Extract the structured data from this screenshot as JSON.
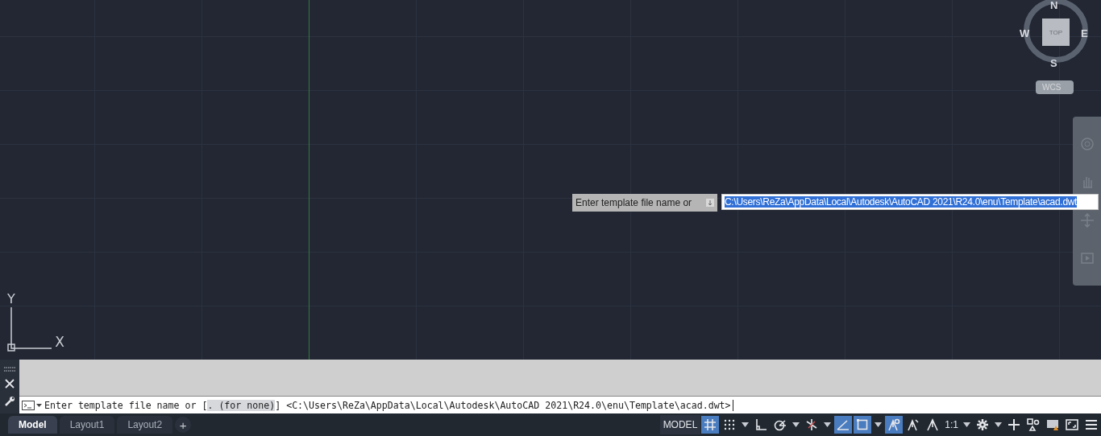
{
  "viewcube": {
    "north": "N",
    "south": "S",
    "east": "E",
    "west": "W",
    "face": "TOP",
    "wcs": "WCS"
  },
  "navigation_bar": {
    "tools": [
      {
        "kind": "steering"
      },
      {
        "kind": "pan"
      },
      {
        "kind": "orbit"
      },
      {
        "kind": "showmotion"
      }
    ]
  },
  "dynamic_input": {
    "prompt": "Enter template file name or",
    "value": "C:\\Users\\ReZa\\AppData\\Local\\Autodesk\\AutoCAD 2021\\R24.0\\enu\\Template\\acad.dwt"
  },
  "ucs": {
    "x": "X",
    "y": "Y"
  },
  "command_line": {
    "before": "Enter template file name or [",
    "option": ". (for none)",
    "after": "] <C:\\Users\\ReZa\\AppData\\Local\\Autodesk\\AutoCAD 2021\\R24.0\\enu\\Template\\acad.dwt>"
  },
  "layout_tabs": [
    {
      "label": "Model",
      "selected": true
    },
    {
      "label": "Layout1",
      "selected": false
    },
    {
      "label": "Layout2",
      "selected": false
    }
  ],
  "add_tab": "+",
  "status_bar": {
    "model": "MODEL",
    "scale": "1:1",
    "tools": [
      {
        "kind": "grid",
        "on": true
      },
      {
        "kind": "snap",
        "on": false
      },
      {
        "kind": "ortho",
        "on": false
      },
      {
        "kind": "polar",
        "on": false
      },
      {
        "kind": "isodraft",
        "on": false
      },
      {
        "kind": "osnaptrack",
        "on": true
      },
      {
        "kind": "osnap",
        "on": true
      },
      {
        "kind": "annovis",
        "on": true
      },
      {
        "kind": "autoscale",
        "on": false
      },
      {
        "kind": "annoscale",
        "on": false
      }
    ],
    "right_tools": [
      {
        "kind": "gear"
      },
      {
        "kind": "plus"
      },
      {
        "kind": "isolate"
      },
      {
        "kind": "hardware"
      },
      {
        "kind": "fullscreen"
      },
      {
        "kind": "menu"
      }
    ]
  }
}
